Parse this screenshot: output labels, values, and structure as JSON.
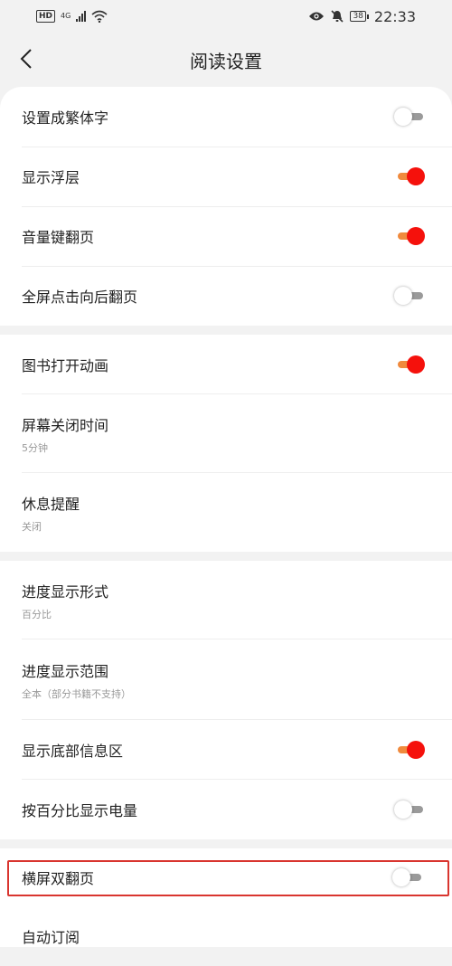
{
  "status": {
    "hd": "HD",
    "network": "4G",
    "battery": "38",
    "time": "22:33"
  },
  "header": {
    "title": "阅读设置"
  },
  "accent": "#f5110c",
  "track_on": "#f08a3d",
  "settings": [
    {
      "label": "设置成繁体字",
      "toggle": "off"
    },
    {
      "label": "显示浮层",
      "toggle": "on"
    },
    {
      "label": "音量键翻页",
      "toggle": "on"
    },
    {
      "label": "全屏点击向后翻页",
      "toggle": "off"
    },
    {
      "label": "图书打开动画",
      "toggle": "on"
    },
    {
      "label": "屏幕关闭时间",
      "sub": "5分钟"
    },
    {
      "label": "休息提醒",
      "sub": "关闭"
    },
    {
      "label": "进度显示形式",
      "sub": "百分比"
    },
    {
      "label": "进度显示范围",
      "sub": "全本（部分书籍不支持）"
    },
    {
      "label": "显示底部信息区",
      "toggle": "on"
    },
    {
      "label": "按百分比显示电量",
      "toggle": "off"
    },
    {
      "label": "横屏双翻页",
      "toggle": "off"
    },
    {
      "label": "自动订阅"
    }
  ]
}
